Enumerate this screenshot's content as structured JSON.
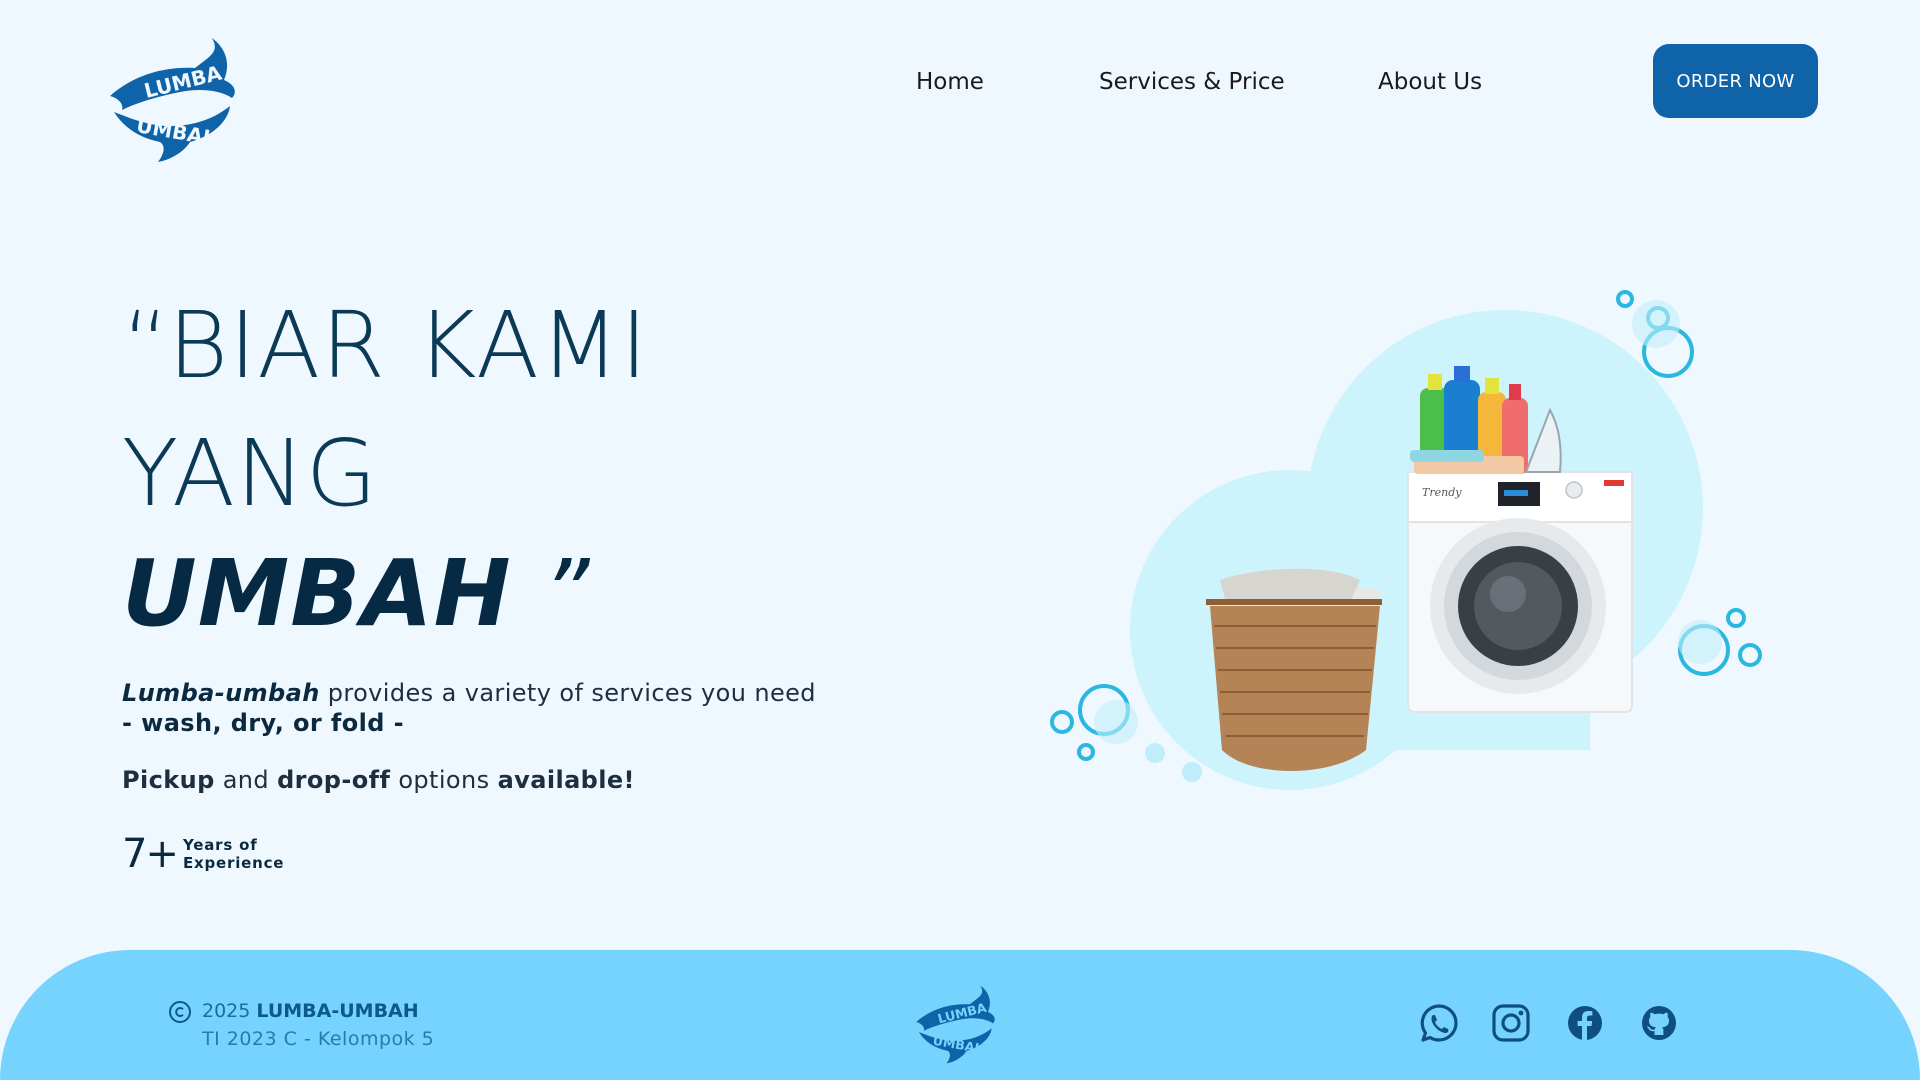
{
  "brand": {
    "logo_top_text": "LUMBA",
    "logo_bottom_text": "UMBAH",
    "color_primary": "#0f63a8",
    "color_footer": "#75d3fd",
    "color_bg": "#f0f8ff"
  },
  "nav": {
    "items": [
      {
        "label": "Home"
      },
      {
        "label": "Services & Price"
      },
      {
        "label": "About Us"
      }
    ],
    "cta_label": "ORDER NOW"
  },
  "hero": {
    "line1": "“BIAR KAMI",
    "line2": "YANG",
    "line3_main": "UMBAH",
    "line3_quote": " ”",
    "desc_brand": "Lumba-umbah",
    "desc_rest": " provides a variety of services you need",
    "desc_services": "- wash, dry, or fold -",
    "pickup_bold": "Pickup",
    "pickup_and": " and ",
    "dropoff_bold": "drop-off",
    "options_text": " options ",
    "available_bold": "available!",
    "experience_number": "7+",
    "experience_line1": "Years of",
    "experience_line2": "Experience"
  },
  "illustration": {
    "washer_brand": "Trendy"
  },
  "footer": {
    "year": "2025",
    "brand": "LUMBA-UMBAH",
    "line2": "TI 2023 C - Kelompok 5",
    "social_icons": [
      "whatsapp-icon",
      "instagram-icon",
      "facebook-icon",
      "github-icon"
    ]
  }
}
